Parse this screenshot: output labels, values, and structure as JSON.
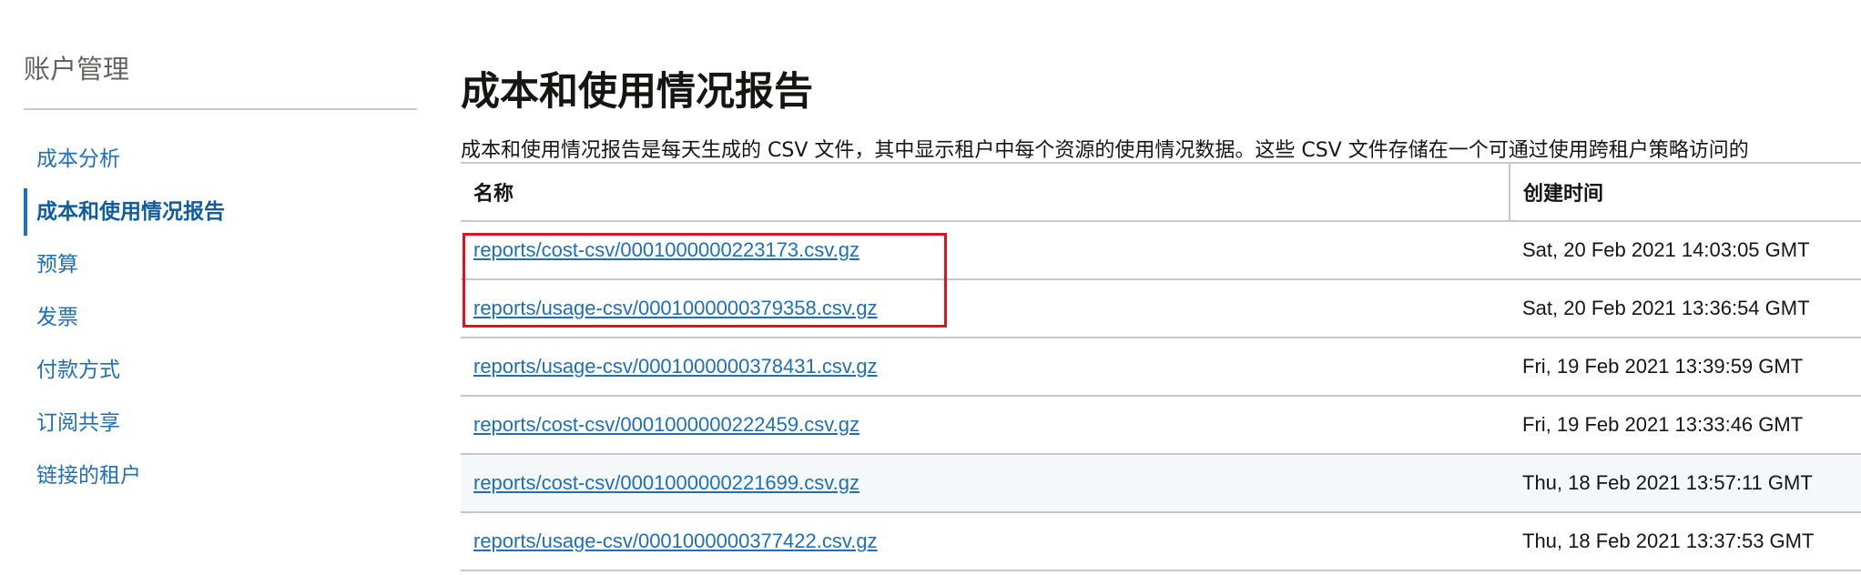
{
  "sidebar": {
    "title": "账户管理",
    "items": [
      {
        "label": "成本分析",
        "active": false
      },
      {
        "label": "成本和使用情况报告",
        "active": true
      },
      {
        "label": "预算",
        "active": false
      },
      {
        "label": "发票",
        "active": false
      },
      {
        "label": "付款方式",
        "active": false
      },
      {
        "label": "订阅共享",
        "active": false
      },
      {
        "label": "链接的租户",
        "active": false
      }
    ]
  },
  "main": {
    "title": "成本和使用情况报告",
    "description": "成本和使用情况报告是每天生成的 CSV 文件，其中显示租户中每个资源的使用情况数据。这些 CSV 文件存储在一个可通过使用跨租户策略访问的",
    "table": {
      "headers": {
        "name": "名称",
        "created": "创建时间"
      },
      "rows": [
        {
          "name": "reports/cost-csv/0001000000223173.csv.gz",
          "created": "Sat, 20 Feb 2021 14:03:05 GMT"
        },
        {
          "name": "reports/usage-csv/0001000000379358.csv.gz",
          "created": "Sat, 20 Feb 2021 13:36:54 GMT"
        },
        {
          "name": "reports/usage-csv/0001000000378431.csv.gz",
          "created": "Fri, 19 Feb 2021 13:39:59 GMT"
        },
        {
          "name": "reports/cost-csv/0001000000222459.csv.gz",
          "created": "Fri, 19 Feb 2021 13:33:46 GMT"
        },
        {
          "name": "reports/cost-csv/0001000000221699.csv.gz",
          "created": "Thu, 18 Feb 2021 13:57:11 GMT"
        },
        {
          "name": "reports/usage-csv/0001000000377422.csv.gz",
          "created": "Thu, 18 Feb 2021 13:37:53 GMT"
        }
      ]
    }
  },
  "colors": {
    "link": "#1e6fb5",
    "highlight": "#e0121f",
    "divider": "#c8c6c4"
  }
}
